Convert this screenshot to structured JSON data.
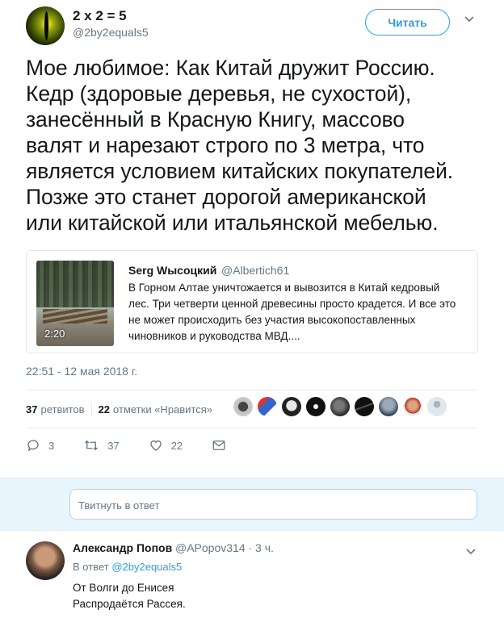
{
  "author": {
    "name": "2 x 2 = 5",
    "handle": "@2by2equals5",
    "follow_label": "Читать"
  },
  "tweet": {
    "lines": [
      "Мое любимое: Как Китай дружит Россию.",
      "Кедр (здоровые деревья, не сухостой),",
      "занесённый в Красную Книгу, массово",
      "валят и нарезают строго по 3 метра, что",
      "является условием китайских покупателей.",
      "Позже это станет дорогой американской",
      "или китайской или итальянской мебелью."
    ],
    "timestamp": "22:51 - 12 мая 2018 г."
  },
  "quote": {
    "name": "Serg Wысоцкий",
    "handle": "@Albertich61",
    "video_duration": "2:20",
    "lines": [
      "В Горном Алтае уничтожается и вывозится в Китай кедровый",
      "лес. Три четверти ценной древесины просто крадется. И все это",
      "не может происходить без участия высокопоставленных",
      "чиновников и руководства МВД...."
    ]
  },
  "stats": {
    "retweets_count": "37",
    "retweets_label": "ретвитов",
    "likes_count": "22",
    "likes_label": "отметки «Нравится»"
  },
  "actions": {
    "reply_count": "3",
    "retweet_count": "37",
    "like_count": "22"
  },
  "reply_box": {
    "placeholder": "Твитнуть в ответ"
  },
  "reply": {
    "name": "Александр Попов",
    "handle": "@APopov314 · 3 ч.",
    "reply_to_prefix": "В ответ",
    "reply_to_handle": "@2by2equals5",
    "lines": [
      "От Волги до Енисея",
      "Распродаётся Рассея."
    ]
  },
  "colors": {
    "accent": "#1da1f2",
    "muted": "#657786",
    "reply_bg": "#e8f5fd"
  }
}
